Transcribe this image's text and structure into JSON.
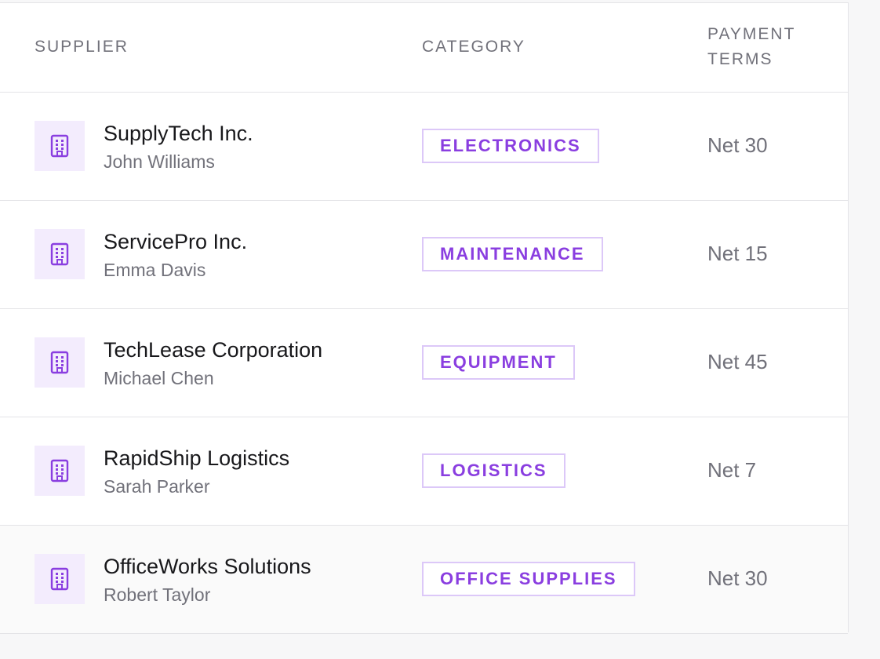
{
  "table": {
    "headers": {
      "supplier": "SUPPLIER",
      "category": "CATEGORY",
      "payment_terms": "PAYMENT TERMS"
    },
    "rows": [
      {
        "name": "SupplyTech Inc.",
        "contact": "John Williams",
        "category": "ELECTRONICS",
        "terms": "Net 30",
        "icon": "building-icon"
      },
      {
        "name": "ServicePro Inc.",
        "contact": "Emma Davis",
        "category": "MAINTENANCE",
        "terms": "Net 15",
        "icon": "building-icon"
      },
      {
        "name": "TechLease Corporation",
        "contact": "Michael Chen",
        "category": "EQUIPMENT",
        "terms": "Net 45",
        "icon": "building-icon"
      },
      {
        "name": "RapidShip Logistics",
        "contact": "Sarah Parker",
        "category": "LOGISTICS",
        "terms": "Net 7",
        "icon": "building-icon"
      },
      {
        "name": "OfficeWorks Solutions",
        "contact": "Robert Taylor",
        "category": "OFFICE SUPPLIES",
        "terms": "Net 30",
        "icon": "building-icon"
      }
    ]
  },
  "colors": {
    "accent": "#8a3ee0",
    "badge_border": "#dcc8f8",
    "icon_bg": "#f3ecfd",
    "muted_text": "#71717a",
    "primary_text": "#18181b"
  }
}
